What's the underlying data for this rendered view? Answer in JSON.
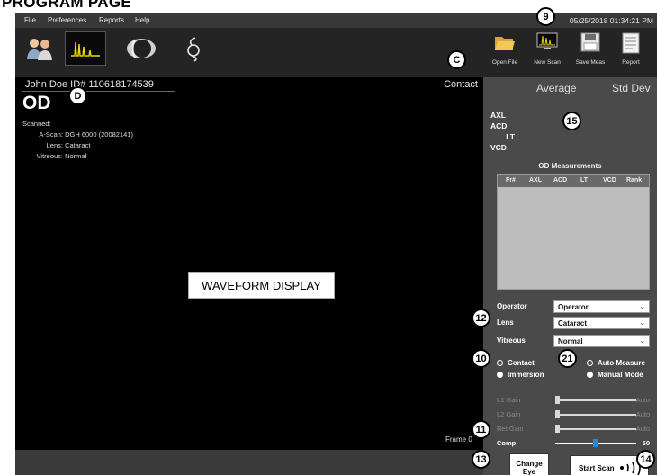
{
  "page": {
    "heading": "PROGRAM PAGE"
  },
  "menu": {
    "items": [
      "File",
      "Preferences",
      "Reports",
      "Help"
    ],
    "datetime": "05/25/2018  01:34:21 PM"
  },
  "toolbar": {
    "open_file": "Open File",
    "new_scan": "New Scan",
    "save_meas": "Save Meas",
    "report": "Report"
  },
  "patient": {
    "line": "John Doe   ID# 110618174539",
    "eye": "OD",
    "scanned_label": "Scanned:",
    "scanned_value": "",
    "ascan_label": "A-Scan:",
    "ascan_value": "DGH 6000 (20082141)",
    "lens_label": "Lens:",
    "lens_value": "Cataract",
    "vitreous_label": "Vitreous:",
    "vitreous_value": "Normal"
  },
  "waveform": {
    "label": "WAVEFORM DISPLAY",
    "mode": "Contact",
    "frame": "Frame 0"
  },
  "stats": {
    "average": "Average",
    "std_dev": "Std Dev",
    "labels": [
      "AXL",
      "ACD",
      "LT",
      "VCD"
    ]
  },
  "measurements": {
    "title": "OD Measurements",
    "columns": [
      "Fr#",
      "AXL",
      "ACD",
      "LT",
      "VCD",
      "Rank"
    ]
  },
  "settings": {
    "operator_label": "Operator",
    "operator_value": "Operator",
    "lens_label": "Lens",
    "lens_value": "Cataract",
    "vitreous_label": "Vitreous",
    "vitreous_value": "Normal"
  },
  "modes": {
    "contact": "Contact",
    "immersion": "Immersion",
    "auto_measure": "Auto Measure",
    "manual_mode": "Manual Mode",
    "contact_selected": false,
    "immersion_selected": true,
    "auto_selected": false,
    "manual_selected": true
  },
  "gains": {
    "l1_label": "L1 Gain",
    "l2_label": "L2 Gain",
    "ret_label": "Ret Gain",
    "comp_label": "Comp",
    "auto": "Auto",
    "comp_value": "50"
  },
  "buttons": {
    "change_eye": "Change Eye",
    "start_scan": "Start Scan"
  },
  "callouts": {
    "c1": "C",
    "d": "D",
    "n9": "9",
    "n15": "15",
    "n12": "12",
    "n10": "10",
    "n21": "21",
    "n11": "11",
    "n13": "13",
    "n14": "14"
  },
  "colors": {
    "app_bg": "#1c1c1c",
    "panel_bg": "#4a4a4a",
    "comp_thumb": "#1e88e5"
  }
}
